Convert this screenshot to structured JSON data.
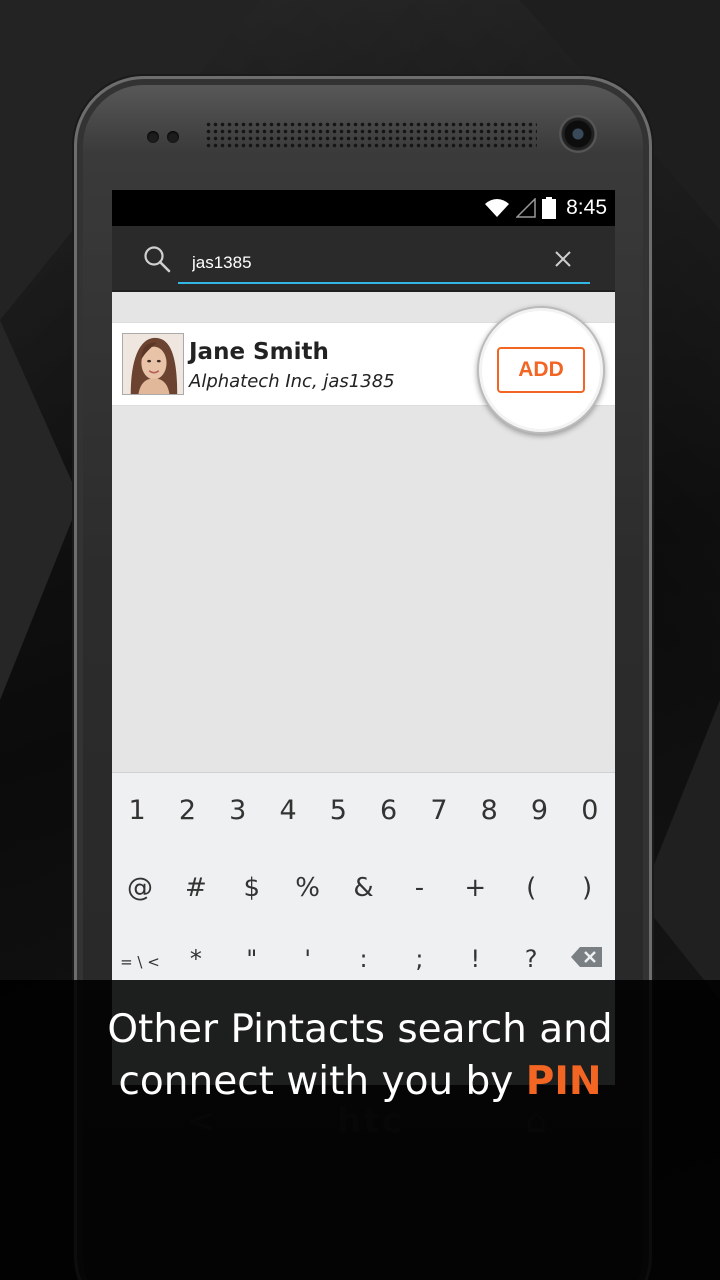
{
  "status_bar": {
    "time": "8:45"
  },
  "search": {
    "query": "jas1385"
  },
  "result": {
    "name": "Jane Smith",
    "subtitle": "Alphatech Inc, jas1385",
    "add_label": "ADD"
  },
  "keyboard": {
    "row1": [
      "1",
      "2",
      "3",
      "4",
      "5",
      "6",
      "7",
      "8",
      "9",
      "0"
    ],
    "row2": [
      "@",
      "#",
      "$",
      "%",
      "&",
      "-",
      "+",
      "(",
      ")"
    ],
    "row3": [
      "= \\ <",
      "*",
      "\"",
      "'",
      ":",
      ";",
      "!",
      "?"
    ]
  },
  "caption": {
    "line1": "Other Pintacts search and",
    "line2_prefix": "connect with you by ",
    "line2_highlight": "PIN"
  },
  "hardware": {
    "brand": "htc"
  },
  "colors": {
    "accent": "#f26522",
    "input_underline": "#33b5e5"
  }
}
